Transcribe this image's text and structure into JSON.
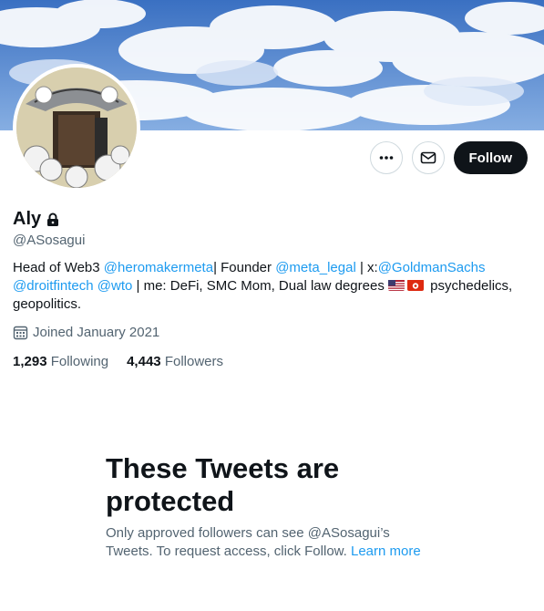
{
  "profile": {
    "name": "Aly",
    "handle": "@ASosagui",
    "bio": {
      "line1_a": "Head of Web3 ",
      "mention1": "@heromakermeta",
      "line1_b": "| Founder ",
      "mention2": "@meta_legal",
      "line1_c": " | x:",
      "mention3": "@GoldmanSachs",
      "mention4": "@droitfintech",
      "mention5": "@wto",
      "line2_b": " | me: DeFi, SMC Mom, Dual law degrees ",
      "line2_c": " psychedelics, geopolitics."
    },
    "joined": "Joined January 2021",
    "following_count": "1,293",
    "following_label": "Following",
    "followers_count": "4,443",
    "followers_label": "Followers"
  },
  "actions": {
    "follow_label": "Follow"
  },
  "protected": {
    "title": "These Tweets are protected",
    "text": "Only approved followers can see @ASosagui’s Tweets. To request access, click Follow. ",
    "link": "Learn more"
  },
  "icons": {
    "more": "more-horizontal-icon",
    "message": "envelope-icon",
    "lock": "lock-icon",
    "calendar": "calendar-icon",
    "flag1": "us-flag-icon",
    "flag2": "hong-kong-flag-icon"
  },
  "colors": {
    "accent": "#1d9bf0",
    "follow_button": "#0f1419",
    "secondary_text": "#536471"
  }
}
